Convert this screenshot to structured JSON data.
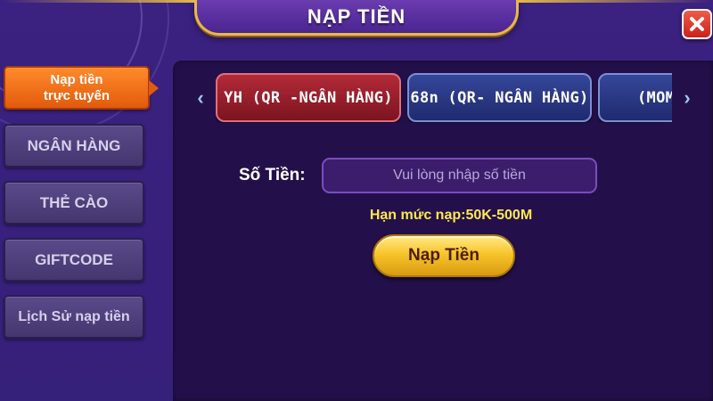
{
  "header": {
    "title": "NẠP TIỀN"
  },
  "sidebar": {
    "items": [
      {
        "label": "Nạp tiền\ntrực tuyến",
        "active": true
      },
      {
        "label": "NGÂN HÀNG",
        "active": false
      },
      {
        "label": "THẺ CÀO",
        "active": false
      },
      {
        "label": "GIFTCODE",
        "active": false
      },
      {
        "label": "Lịch Sử nạp tiền",
        "active": false
      }
    ]
  },
  "tabs": [
    {
      "label": "YH (QR -NGÂN HÀNG)",
      "active": true
    },
    {
      "label": "68n (QR- NGÂN HÀNG)",
      "active": false
    },
    {
      "label": "(MOM",
      "active": false
    }
  ],
  "form": {
    "amount_label": "Số Tiền:",
    "amount_placeholder": "Vui lòng nhập số tiền",
    "amount_value": "",
    "limit_text": "Hạn mức nạp:50K-500M",
    "submit_label": "Nạp Tiền"
  },
  "icons": {
    "close": "close-icon",
    "prev": "chevron-left-icon",
    "next": "chevron-right-icon"
  },
  "colors": {
    "accent_orange": "#e35a0d",
    "active_tab": "#b32a38",
    "inactive_tab": "#35469a",
    "limit_yellow": "#ffe94d",
    "gold_button": "#f7c52a",
    "close_red": "#c7221b"
  }
}
